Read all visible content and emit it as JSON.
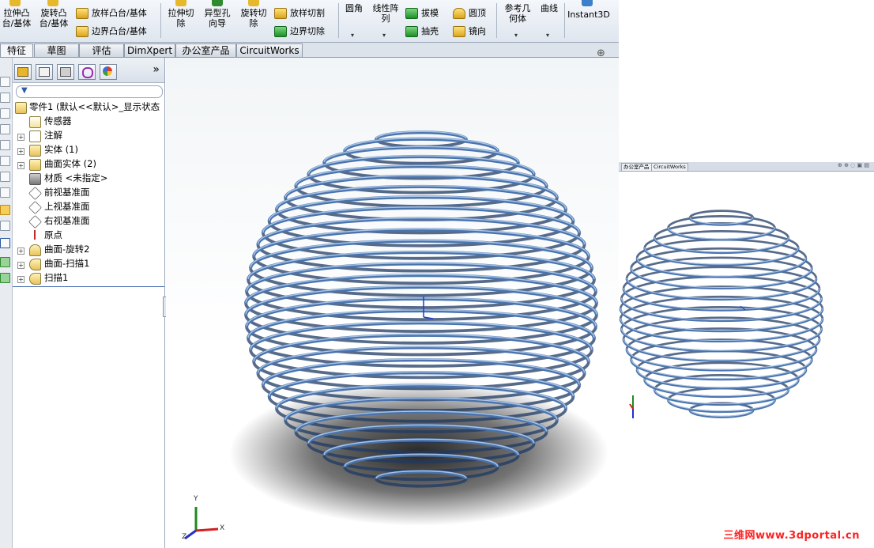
{
  "ribbon": {
    "extrude_boss": "拉伸凸\n台/基体",
    "revolve_boss": "旋转凸\n台/基体",
    "loft_boss": "放样凸台/基体",
    "boundary_boss": "边界凸台/基体",
    "extrude_cut": "拉伸切\n除",
    "hole_wizard": "异型孔\n向导",
    "revolve_cut": "旋转切\n除",
    "loft_cut": "放样切割",
    "boundary_cut": "边界切除",
    "fillet": "圆角",
    "linear_pattern": "线性阵\n列",
    "draft": "拔模",
    "shell": "抽壳",
    "dome": "圆顶",
    "mirror": "镜向",
    "ref_geometry": "参考几\n何体",
    "curves": "曲线",
    "instant3d": "Instant3D"
  },
  "tabs": [
    "特征",
    "草图",
    "评估",
    "DimXpert",
    "办公室产品",
    "CircuitWorks"
  ],
  "tabs2": [
    "办公室产品",
    "CircuitWorks"
  ],
  "tree": {
    "root": "零件1  (默认<<默认>_显示状态",
    "items": [
      "传感器",
      "注解",
      "实体 (1)",
      "曲面实体 (2)",
      "材质 <未指定>",
      "前视基准面",
      "上视基准面",
      "右视基准面",
      "原点",
      "曲面-旋转2",
      "曲面-扫描1",
      "扫描1"
    ]
  },
  "fm_more": "»",
  "axes": {
    "x": "X",
    "y": "Y",
    "z": "Z"
  },
  "watermark": "三维网www.3dportal.cn",
  "colors": {
    "coil": "#4a74ad",
    "coil_light": "#a9c4e6",
    "coil_dark": "#1f3a63",
    "accent": "#2b5ea8"
  }
}
